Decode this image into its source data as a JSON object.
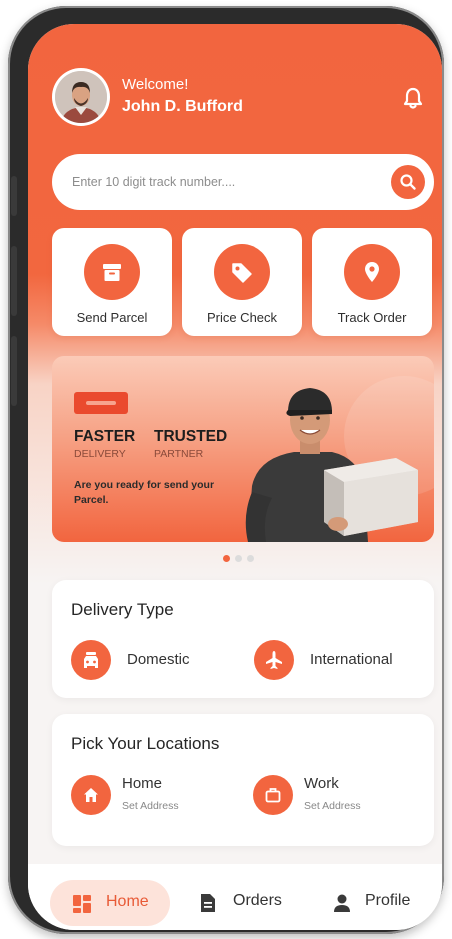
{
  "header": {
    "welcome": "Welcome!",
    "user_name": "John D. Bufford"
  },
  "search": {
    "placeholder": "Enter 10 digit track number...."
  },
  "actions": [
    {
      "label": "Send Parcel",
      "icon": "box-icon"
    },
    {
      "label": "Price Check",
      "icon": "tag-icon"
    },
    {
      "label": "Track Order",
      "icon": "location-pin-icon"
    }
  ],
  "banner": {
    "headline1": "FASTER",
    "sub1": "DELIVERY",
    "headline2": "TRUSTED",
    "sub2": "PARTNER",
    "text": "Are you ready for send your Parcel."
  },
  "carousel": {
    "count": 3,
    "active": 1
  },
  "delivery_type": {
    "title": "Delivery Type",
    "options": [
      {
        "label": "Domestic",
        "icon": "car-icon"
      },
      {
        "label": "International",
        "icon": "plane-icon"
      }
    ]
  },
  "locations": {
    "title": "Pick Your Locations",
    "options": [
      {
        "label": "Home",
        "sub": "Set Address",
        "icon": "home-icon"
      },
      {
        "label": "Work",
        "sub": "Set Address",
        "icon": "briefcase-icon"
      }
    ]
  },
  "nav": {
    "items": [
      {
        "label": "Home",
        "icon": "grid-icon",
        "active": true
      },
      {
        "label": "Orders",
        "icon": "document-icon",
        "active": false
      },
      {
        "label": "Profile",
        "icon": "user-icon",
        "active": false
      }
    ]
  },
  "colors": {
    "accent": "#f2653f",
    "accent_light": "#fde3da",
    "background": "#f7f4f3"
  }
}
